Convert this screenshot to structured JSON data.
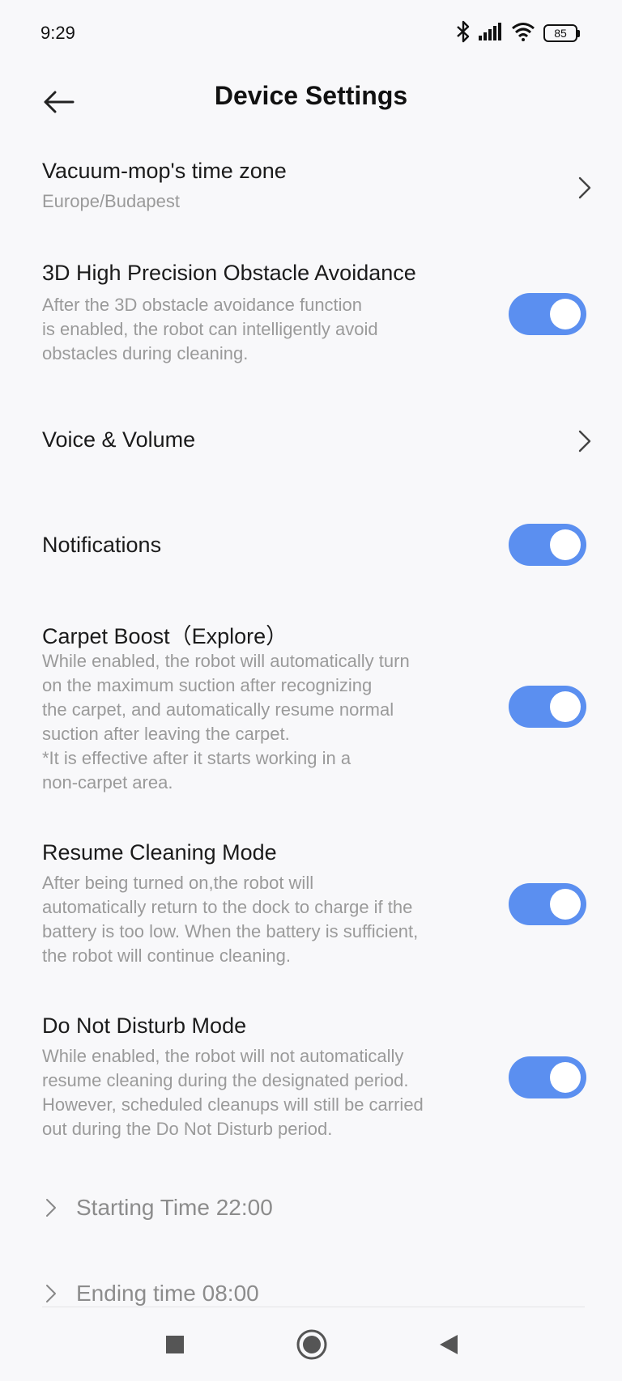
{
  "status": {
    "time": "9:29",
    "battery": "85",
    "icons": [
      "bluetooth-icon",
      "signal-icon",
      "wifi-icon",
      "battery-icon"
    ]
  },
  "header": {
    "title": "Device Settings"
  },
  "settings": {
    "timezone": {
      "title": "Vacuum-mop's time zone",
      "subtitle": "Europe/Budapest"
    },
    "obstacle": {
      "title": "3D High Precision Obstacle Avoidance",
      "desc": [
        "After the 3D obstacle avoidance function",
        "is enabled, the robot can intelligently avoid",
        "obstacles during cleaning."
      ],
      "enabled": true
    },
    "voice": {
      "title": "Voice & Volume"
    },
    "notifications": {
      "title": "Notifications",
      "enabled": true
    },
    "carpet": {
      "title": "Carpet Boost（Explore）",
      "desc": [
        "While enabled, the robot will automatically turn",
        "on the maximum suction after recognizing",
        "the carpet, and automatically resume normal",
        "suction after leaving the carpet.",
        "*It is effective after it starts working in a",
        "non-carpet area."
      ],
      "enabled": true
    },
    "resume": {
      "title": "Resume Cleaning Mode",
      "desc": [
        "After being turned on,the robot will",
        "automatically return to the dock to charge if the",
        "battery is too low. When the battery is sufficient,",
        "the robot will continue cleaning."
      ],
      "enabled": true
    },
    "dnd": {
      "title": "Do Not Disturb Mode",
      "desc": [
        "While enabled, the robot will not automatically",
        "resume cleaning during the designated period.",
        "However, scheduled cleanups will still be carried",
        "out during the Do Not Disturb period."
      ],
      "enabled": true,
      "start": "Starting Time 22:00",
      "end": "Ending time 08:00"
    }
  },
  "colors": {
    "toggle_on": "#5b8ff0",
    "secondary_text": "#9a9a9a"
  },
  "navigation": {
    "buttons": [
      "recents-button",
      "home-button",
      "back-button"
    ]
  }
}
